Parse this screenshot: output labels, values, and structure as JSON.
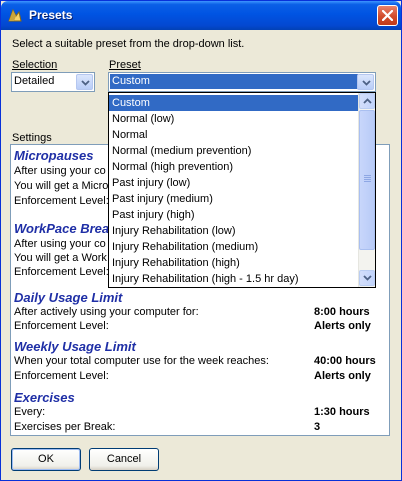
{
  "window": {
    "title": "Presets",
    "title_icon": "app-logo-icon",
    "close_icon": "close-icon"
  },
  "instruction": "Select a suitable preset from the drop-down list.",
  "selection": {
    "label": "Selection",
    "value": "Detailed"
  },
  "preset": {
    "label": "Preset",
    "value": "Custom",
    "options": [
      "Custom",
      "Normal (low)",
      "Normal",
      "Normal (medium prevention)",
      "Normal (high prevention)",
      "Past injury (low)",
      "Past injury (medium)",
      "Past injury (high)",
      "Injury Rehabilitation (low)",
      "Injury Rehabilitation (medium)",
      "Injury Rehabilitation (high)",
      "Injury Rehabilitation (high - 1.5 hr day)"
    ]
  },
  "settings": {
    "label": "Settings",
    "micropauses": {
      "title": "Micropauses",
      "row1": "After using your co",
      "row2": "You will get a Micro",
      "row3": "Enforcement Level:"
    },
    "workpace": {
      "title": "WorkPace Brea",
      "row1": "After using your co",
      "row2": "You will get a Work",
      "row3": "Enforcement Level:"
    },
    "daily": {
      "title": "Daily Usage Limit",
      "row1_label": "After actively using your computer for:",
      "row1_value": "8:00 hours",
      "row2_label": "Enforcement Level:",
      "row2_value": "Alerts only"
    },
    "weekly": {
      "title": "Weekly Usage Limit",
      "row1_label": "When your total computer use for the week reaches:",
      "row1_value": "40:00 hours",
      "row2_label": "Enforcement Level:",
      "row2_value": "Alerts only"
    },
    "exercises": {
      "title": "Exercises",
      "row1_label": "Every:",
      "row1_value": "1:30 hours",
      "row2_label": "Exercises per Break:",
      "row2_value": "3"
    }
  },
  "buttons": {
    "ok": "OK",
    "cancel": "Cancel"
  }
}
